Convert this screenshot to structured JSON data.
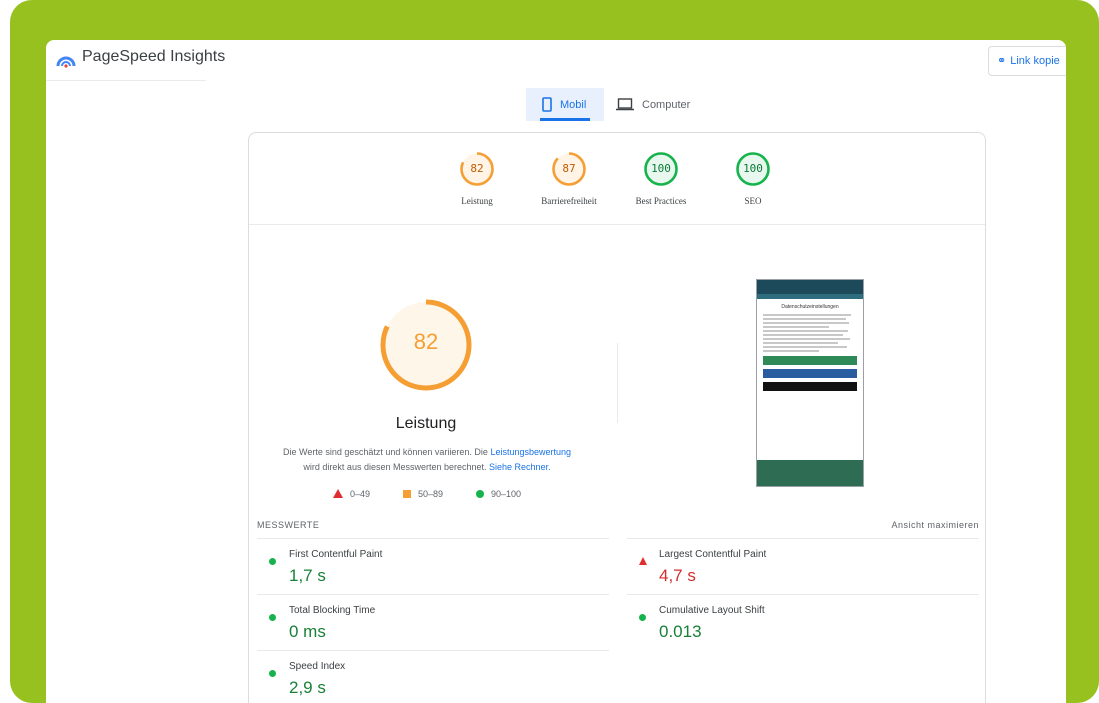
{
  "app": {
    "title": "PageSpeed Insights",
    "link_copy": "Link kopie"
  },
  "tabs": [
    {
      "label": "Mobil",
      "icon": "smartphone-icon",
      "active": true
    },
    {
      "label": "Computer",
      "icon": "laptop-icon",
      "active": false
    }
  ],
  "categories": [
    {
      "score": "82",
      "label": "Leistung",
      "rating": "average"
    },
    {
      "score": "87",
      "label": "Barrierefreiheit",
      "rating": "average"
    },
    {
      "score": "100",
      "label": "Best Practices",
      "rating": "good"
    },
    {
      "score": "100",
      "label": "SEO",
      "rating": "good"
    }
  ],
  "performance": {
    "score": "82",
    "label": "Leistung",
    "desc_1": "Die Werte sind geschätzt und können variieren. Die",
    "desc_link_1": "Leistungsbewertung",
    "desc_2": "wird direkt aus diesen Messwerten berechnet.",
    "desc_link_2": "Siehe Rechner."
  },
  "legend": [
    {
      "range": "0–49",
      "shape": "triangle"
    },
    {
      "range": "50–89",
      "shape": "square"
    },
    {
      "range": "90–100",
      "shape": "circle"
    }
  ],
  "metrics_header": {
    "title": "MESSWERTE",
    "expand_label": "Ansicht maximieren"
  },
  "metrics": [
    {
      "name": "First Contentful Paint",
      "value": "1,7 s",
      "rating": "good"
    },
    {
      "name": "Largest Contentful Paint",
      "value": "4,7 s",
      "rating": "poor"
    },
    {
      "name": "Total Blocking Time",
      "value": "0 ms",
      "rating": "good"
    },
    {
      "name": "Cumulative Layout Shift",
      "value": "0.013",
      "rating": "good"
    },
    {
      "name": "Speed Index",
      "value": "2,9 s",
      "rating": "good"
    }
  ],
  "screenshot_preview": {
    "title": "Datenschutzeinstellungen"
  },
  "colors": {
    "frame": "#97c11f",
    "average": "#f59e33",
    "good": "#15b34c",
    "poor": "#e02e2e",
    "accent": "#1a73e8"
  }
}
